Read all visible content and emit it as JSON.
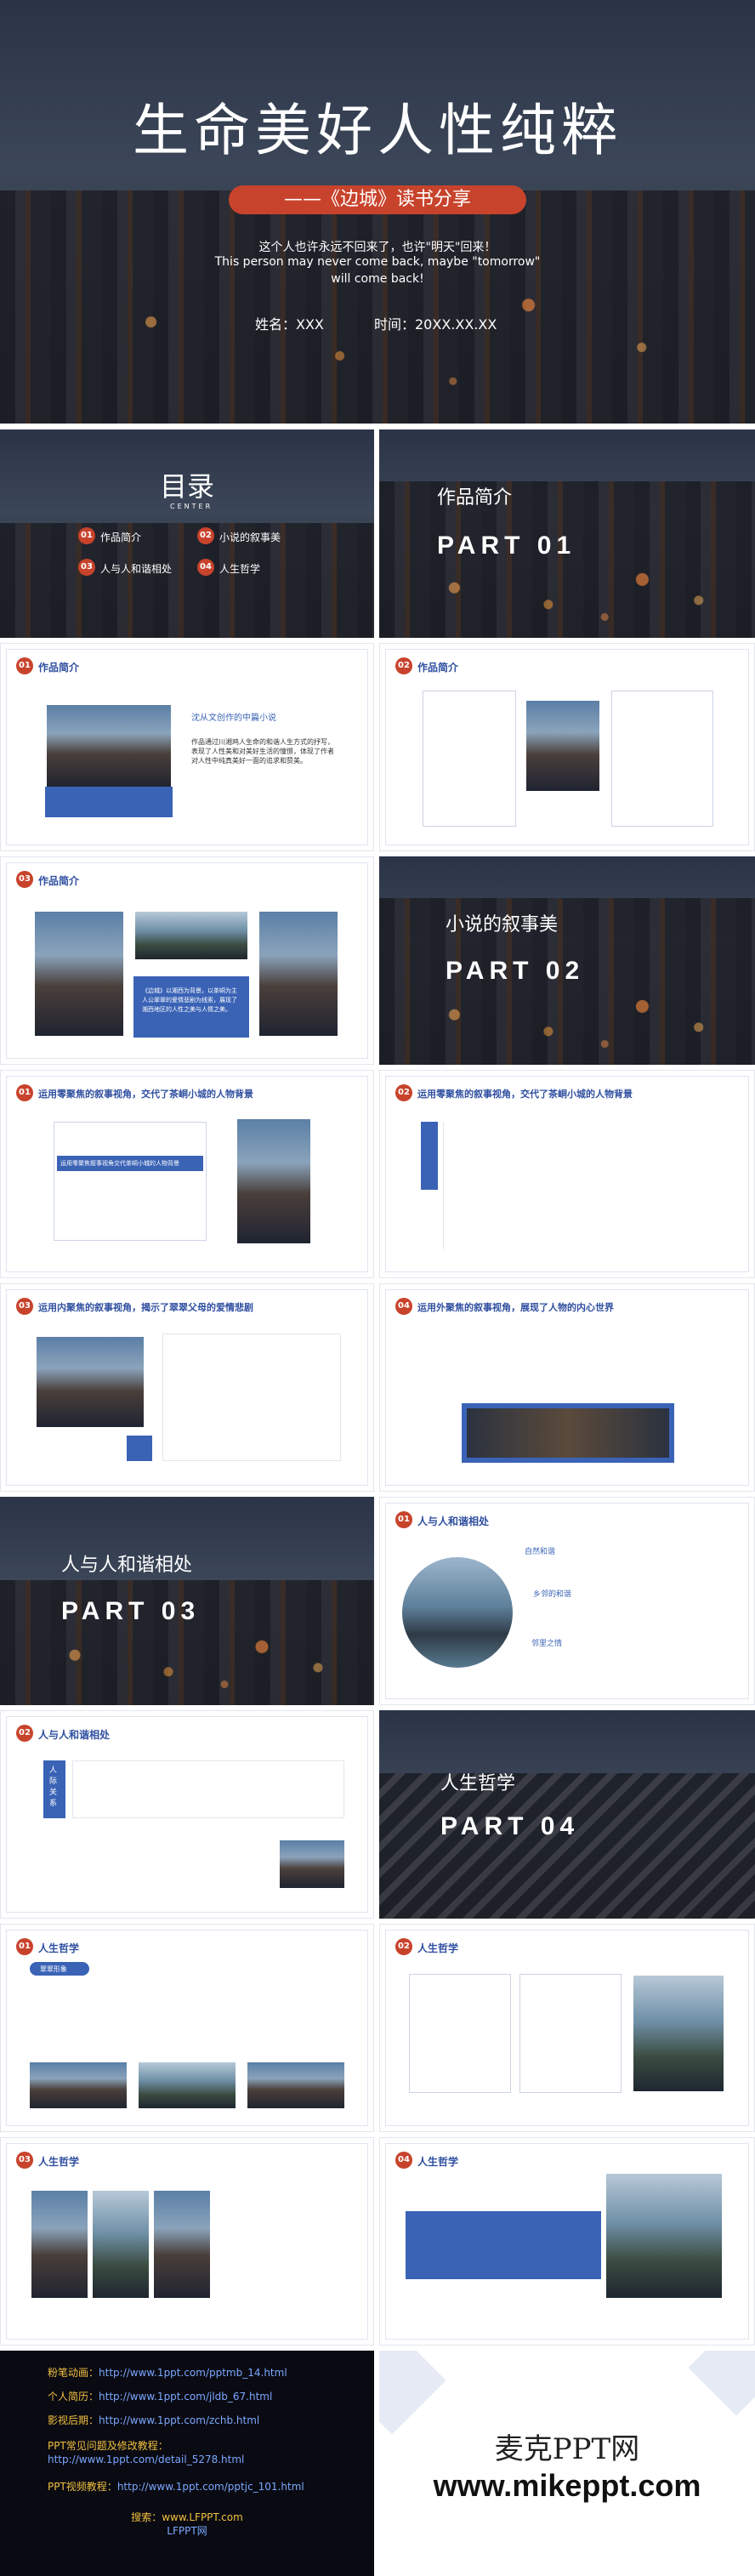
{
  "cover": {
    "title": "生命美好人性纯粹",
    "subtitle": "——《边城》读书分享",
    "quote_cn": "这个人也许永远不回来了，也许\"明天\"回来！",
    "quote_en1": "This person may never come back, maybe \"tomorrow\"",
    "quote_en2": "will come back!",
    "name": "姓名：XXX",
    "date": "时间：20XX.XX.XX"
  },
  "toc": {
    "title": "目录",
    "sub": "CENTER",
    "items": [
      {
        "num": "01",
        "label": "作品简介"
      },
      {
        "num": "02",
        "label": "小说的叙事美"
      },
      {
        "num": "03",
        "label": "人与人和谐相处"
      },
      {
        "num": "04",
        "label": "人生哲学"
      }
    ]
  },
  "part1": {
    "title": "作品简介",
    "part": "PART 01"
  },
  "part2": {
    "title": "小说的叙事美",
    "part": "PART 02"
  },
  "part3": {
    "title": "人与人和谐相处",
    "part": "PART 03"
  },
  "part4": {
    "title": "人生哲学",
    "part": "PART 04"
  },
  "s3": {
    "num": "01",
    "title": "作品简介",
    "heading": "沈从文创作的中篇小说",
    "body": "作品通过川湘鸡人生命的和谐人生方式的抒写，表现了人性美和对美好生活的憧憬，体现了作者对人性中纯真美好一面的追求和赞美。"
  },
  "s4": {
    "num": "02",
    "title": "作品简介"
  },
  "s5": {
    "num": "03",
    "title": "作品简介",
    "box": "《边城》以湘西为背景，以茶峒为主人公翠翠的爱情悲剧为线索，展现了湘西地区的人性之美与人情之美。"
  },
  "s7": {
    "num": "01",
    "title": "运用零聚焦的叙事视角，交代了茶峒小城的人物背景",
    "box": "运用零聚焦叙事视角交代茶峒小城的人物背景"
  },
  "s8": {
    "num": "02",
    "title": "运用零聚焦的叙事视角，交代了茶峒小城的人物背景"
  },
  "s9": {
    "num": "03",
    "title": "运用内聚焦的叙事视角，揭示了翠翠父母的爱情悲剧"
  },
  "s10": {
    "num": "04",
    "title": "运用外聚焦的叙事视角，展现了人物的内心世界"
  },
  "s12": {
    "num": "01",
    "title": "人与人和谐相处",
    "h1": "自然和谐",
    "h2": "乡邻的和谐",
    "h3": "邻里之情"
  },
  "s13": {
    "num": "02",
    "title": "人与人和谐相处",
    "label": "人际关系"
  },
  "s15": {
    "num": "01",
    "title": "人生哲学",
    "tag": "翠翠形象"
  },
  "s16": {
    "num": "02",
    "title": "人生哲学"
  },
  "s17": {
    "num": "03",
    "title": "人生哲学"
  },
  "s18": {
    "num": "04",
    "title": "人生哲学"
  },
  "footer": {
    "links": [
      {
        "label": "粉笔动画：",
        "url": "http://www.1ppt.com/pptmb_14.html"
      },
      {
        "label": "个人简历：",
        "url": "http://www.1ppt.com/jldb_67.html"
      },
      {
        "label": "影视后期：",
        "url": "http://www.1ppt.com/zchb.html"
      },
      {
        "label": "PPT常见问题及修改教程：",
        "url": "http://www.1ppt.com/detail_5278.html"
      },
      {
        "label": "PPT视频教程：",
        "url": "http://www.1ppt.com/pptjc_101.html"
      }
    ],
    "search": "搜索：www.LFPPT.com",
    "lfppt": "LFPPT网",
    "brand_cn": "麦克PPT网",
    "brand_url": "www.mikeppt.com"
  }
}
